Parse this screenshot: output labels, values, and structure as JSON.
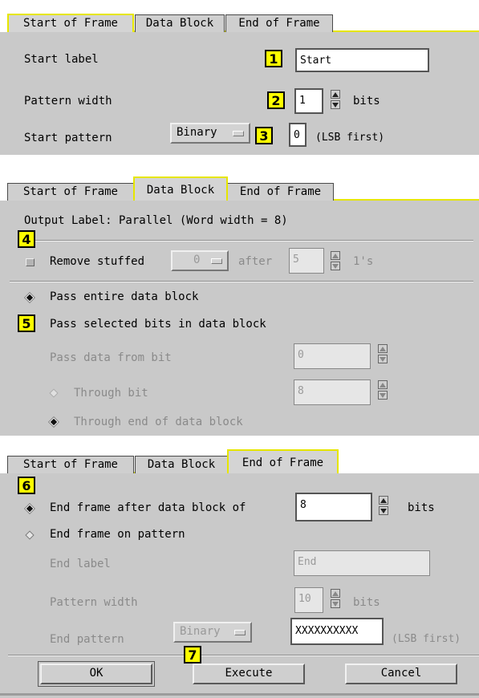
{
  "tabs": [
    "Start of Frame",
    "Data Block",
    "End of Frame"
  ],
  "panel1": {
    "start_label": "Start label",
    "start_label_value": "Start",
    "pattern_width": "Pattern width",
    "pattern_width_value": "1",
    "bits": "bits",
    "start_pattern": "Start pattern",
    "format": "Binary",
    "pattern_value": "0",
    "lsb": "(LSB first)"
  },
  "panel2": {
    "output_label": "Output Label: Parallel (Word width = 8)",
    "remove_stuffed": "Remove stuffed",
    "stuffed_value": "0",
    "after": "after",
    "after_value": "5",
    "ones": "1's",
    "pass_entire": "Pass entire data block",
    "pass_selected": "Pass selected bits in data block",
    "pass_from_bit": "Pass data from bit",
    "pass_from_value": "0",
    "through_bit": "Through bit",
    "through_bit_value": "8",
    "through_end": "Through end of data block"
  },
  "panel3": {
    "end_after_block": "End frame after data block of",
    "end_after_value": "8",
    "bits": "bits",
    "end_on_pattern": "End frame on pattern",
    "end_label": "End label",
    "end_label_value": "End",
    "pattern_width": "Pattern width",
    "pattern_width_value": "10",
    "bits2": "bits",
    "end_pattern": "End pattern",
    "format": "Binary",
    "pattern_value": "XXXXXXXXXX",
    "lsb": "(LSB first)"
  },
  "buttons": {
    "ok": "OK",
    "execute": "Execute",
    "cancel": "Cancel"
  },
  "badges": [
    "1",
    "2",
    "3",
    "4",
    "5",
    "6",
    "7"
  ],
  "colors": {
    "highlight": "#ffff00",
    "active_tab_border": "#e6e600",
    "panel": "#c9c9c9"
  }
}
